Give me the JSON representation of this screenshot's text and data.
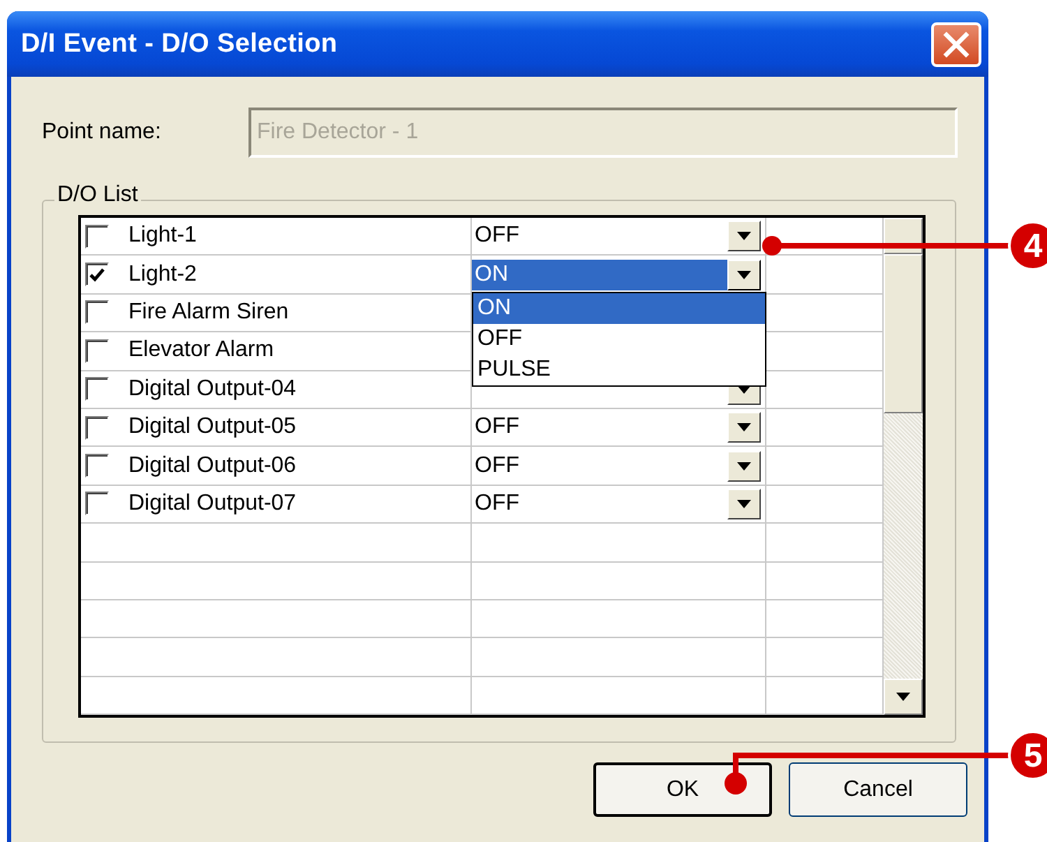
{
  "window": {
    "title": "D/I Event - D/O Selection"
  },
  "point_name": {
    "label": "Point name:",
    "value": "Fire Detector - 1",
    "disabled": true
  },
  "group": {
    "title": "D/O List"
  },
  "rows": [
    {
      "kind": "item",
      "checked": false,
      "selected": false,
      "name": "Light-1",
      "value": "OFF"
    },
    {
      "kind": "item",
      "checked": true,
      "selected": true,
      "name": "Light-2",
      "value": "ON",
      "dropdown": {
        "options": [
          {
            "label": "ON",
            "selected": true
          },
          {
            "label": "OFF",
            "selected": false
          },
          {
            "label": "PULSE",
            "selected": false
          }
        ]
      }
    },
    {
      "kind": "covered",
      "checked": false,
      "name": "Fire Alarm Siren"
    },
    {
      "kind": "covered",
      "checked": false,
      "name": "Elevator Alarm"
    },
    {
      "kind": "item",
      "checked": false,
      "selected": false,
      "name": "Digital Output-04"
    },
    {
      "kind": "item",
      "checked": false,
      "selected": false,
      "name": "Digital Output-05",
      "value": "OFF"
    },
    {
      "kind": "item",
      "checked": false,
      "selected": false,
      "name": "Digital Output-06",
      "value": "OFF"
    },
    {
      "kind": "item",
      "checked": false,
      "selected": false,
      "name": "Digital Output-07",
      "value": "OFF"
    },
    {
      "kind": "empty"
    },
    {
      "kind": "empty"
    },
    {
      "kind": "empty"
    },
    {
      "kind": "empty"
    },
    {
      "kind": "empty"
    }
  ],
  "buttons": [
    {
      "label": "OK"
    },
    {
      "label": "Cancel"
    }
  ],
  "callouts": [
    {
      "label": "4"
    },
    {
      "label": "5"
    }
  ]
}
